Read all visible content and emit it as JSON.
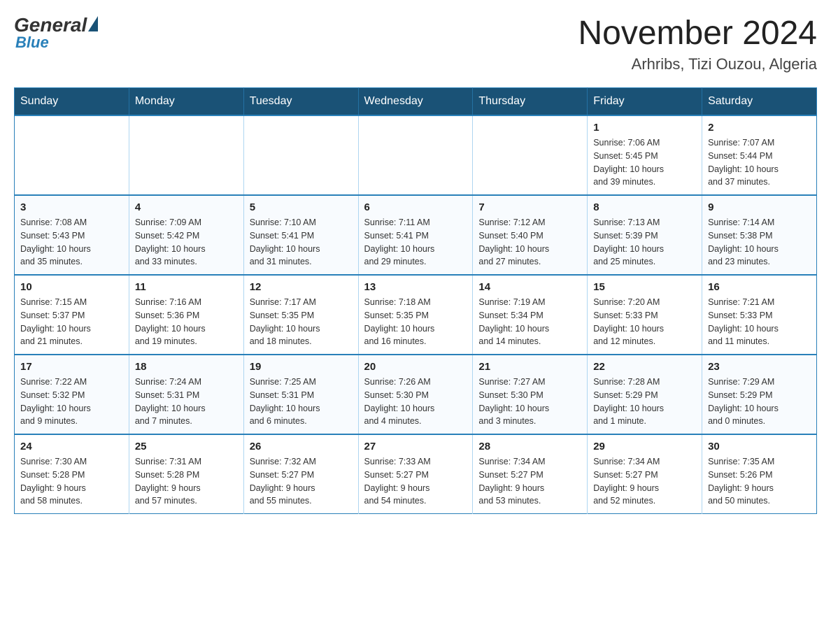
{
  "header": {
    "logo": {
      "general": "General",
      "blue": "Blue"
    },
    "title": "November 2024",
    "subtitle": "Arhribs, Tizi Ouzou, Algeria"
  },
  "calendar": {
    "days_of_week": [
      "Sunday",
      "Monday",
      "Tuesday",
      "Wednesday",
      "Thursday",
      "Friday",
      "Saturday"
    ],
    "weeks": [
      [
        {
          "day": "",
          "info": ""
        },
        {
          "day": "",
          "info": ""
        },
        {
          "day": "",
          "info": ""
        },
        {
          "day": "",
          "info": ""
        },
        {
          "day": "",
          "info": ""
        },
        {
          "day": "1",
          "info": "Sunrise: 7:06 AM\nSunset: 5:45 PM\nDaylight: 10 hours\nand 39 minutes."
        },
        {
          "day": "2",
          "info": "Sunrise: 7:07 AM\nSunset: 5:44 PM\nDaylight: 10 hours\nand 37 minutes."
        }
      ],
      [
        {
          "day": "3",
          "info": "Sunrise: 7:08 AM\nSunset: 5:43 PM\nDaylight: 10 hours\nand 35 minutes."
        },
        {
          "day": "4",
          "info": "Sunrise: 7:09 AM\nSunset: 5:42 PM\nDaylight: 10 hours\nand 33 minutes."
        },
        {
          "day": "5",
          "info": "Sunrise: 7:10 AM\nSunset: 5:41 PM\nDaylight: 10 hours\nand 31 minutes."
        },
        {
          "day": "6",
          "info": "Sunrise: 7:11 AM\nSunset: 5:41 PM\nDaylight: 10 hours\nand 29 minutes."
        },
        {
          "day": "7",
          "info": "Sunrise: 7:12 AM\nSunset: 5:40 PM\nDaylight: 10 hours\nand 27 minutes."
        },
        {
          "day": "8",
          "info": "Sunrise: 7:13 AM\nSunset: 5:39 PM\nDaylight: 10 hours\nand 25 minutes."
        },
        {
          "day": "9",
          "info": "Sunrise: 7:14 AM\nSunset: 5:38 PM\nDaylight: 10 hours\nand 23 minutes."
        }
      ],
      [
        {
          "day": "10",
          "info": "Sunrise: 7:15 AM\nSunset: 5:37 PM\nDaylight: 10 hours\nand 21 minutes."
        },
        {
          "day": "11",
          "info": "Sunrise: 7:16 AM\nSunset: 5:36 PM\nDaylight: 10 hours\nand 19 minutes."
        },
        {
          "day": "12",
          "info": "Sunrise: 7:17 AM\nSunset: 5:35 PM\nDaylight: 10 hours\nand 18 minutes."
        },
        {
          "day": "13",
          "info": "Sunrise: 7:18 AM\nSunset: 5:35 PM\nDaylight: 10 hours\nand 16 minutes."
        },
        {
          "day": "14",
          "info": "Sunrise: 7:19 AM\nSunset: 5:34 PM\nDaylight: 10 hours\nand 14 minutes."
        },
        {
          "day": "15",
          "info": "Sunrise: 7:20 AM\nSunset: 5:33 PM\nDaylight: 10 hours\nand 12 minutes."
        },
        {
          "day": "16",
          "info": "Sunrise: 7:21 AM\nSunset: 5:33 PM\nDaylight: 10 hours\nand 11 minutes."
        }
      ],
      [
        {
          "day": "17",
          "info": "Sunrise: 7:22 AM\nSunset: 5:32 PM\nDaylight: 10 hours\nand 9 minutes."
        },
        {
          "day": "18",
          "info": "Sunrise: 7:24 AM\nSunset: 5:31 PM\nDaylight: 10 hours\nand 7 minutes."
        },
        {
          "day": "19",
          "info": "Sunrise: 7:25 AM\nSunset: 5:31 PM\nDaylight: 10 hours\nand 6 minutes."
        },
        {
          "day": "20",
          "info": "Sunrise: 7:26 AM\nSunset: 5:30 PM\nDaylight: 10 hours\nand 4 minutes."
        },
        {
          "day": "21",
          "info": "Sunrise: 7:27 AM\nSunset: 5:30 PM\nDaylight: 10 hours\nand 3 minutes."
        },
        {
          "day": "22",
          "info": "Sunrise: 7:28 AM\nSunset: 5:29 PM\nDaylight: 10 hours\nand 1 minute."
        },
        {
          "day": "23",
          "info": "Sunrise: 7:29 AM\nSunset: 5:29 PM\nDaylight: 10 hours\nand 0 minutes."
        }
      ],
      [
        {
          "day": "24",
          "info": "Sunrise: 7:30 AM\nSunset: 5:28 PM\nDaylight: 9 hours\nand 58 minutes."
        },
        {
          "day": "25",
          "info": "Sunrise: 7:31 AM\nSunset: 5:28 PM\nDaylight: 9 hours\nand 57 minutes."
        },
        {
          "day": "26",
          "info": "Sunrise: 7:32 AM\nSunset: 5:27 PM\nDaylight: 9 hours\nand 55 minutes."
        },
        {
          "day": "27",
          "info": "Sunrise: 7:33 AM\nSunset: 5:27 PM\nDaylight: 9 hours\nand 54 minutes."
        },
        {
          "day": "28",
          "info": "Sunrise: 7:34 AM\nSunset: 5:27 PM\nDaylight: 9 hours\nand 53 minutes."
        },
        {
          "day": "29",
          "info": "Sunrise: 7:34 AM\nSunset: 5:27 PM\nDaylight: 9 hours\nand 52 minutes."
        },
        {
          "day": "30",
          "info": "Sunrise: 7:35 AM\nSunset: 5:26 PM\nDaylight: 9 hours\nand 50 minutes."
        }
      ]
    ]
  }
}
